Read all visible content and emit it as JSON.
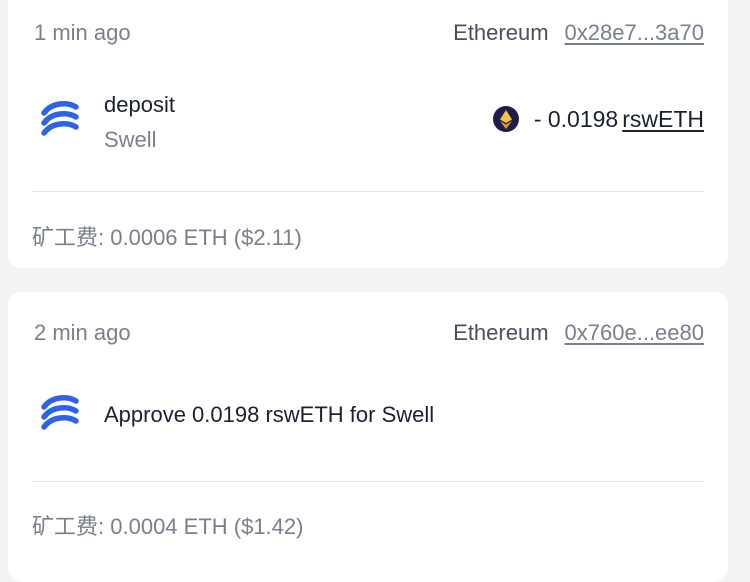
{
  "transactions": [
    {
      "time": "1 min ago",
      "chain": "Ethereum",
      "hash": "0x28e7...3a70",
      "title": "deposit",
      "subtitle": "Swell",
      "amount": "- 0.0198",
      "amount_token": "rswETH",
      "fee_label": "矿工费:",
      "fee_value": "0.0006 ETH ($2.11)",
      "protocol_icon": "swell-logo-icon",
      "token_icon": "eth-icon"
    },
    {
      "time": "2 min ago",
      "chain": "Ethereum",
      "hash": "0x760e...ee80",
      "title": "Approve 0.0198 rswETH for Swell",
      "fee_label": "矿工费:",
      "fee_value": "0.0004 ETH ($1.42)",
      "protocol_icon": "swell-logo-icon"
    }
  ],
  "colors": {
    "background": "#f2f3f5",
    "card": "#ffffff",
    "swell_blue": "#2e63e6",
    "eth_badge_bg": "#1f1b4d",
    "eth_badge_gold": "#f0b429"
  }
}
